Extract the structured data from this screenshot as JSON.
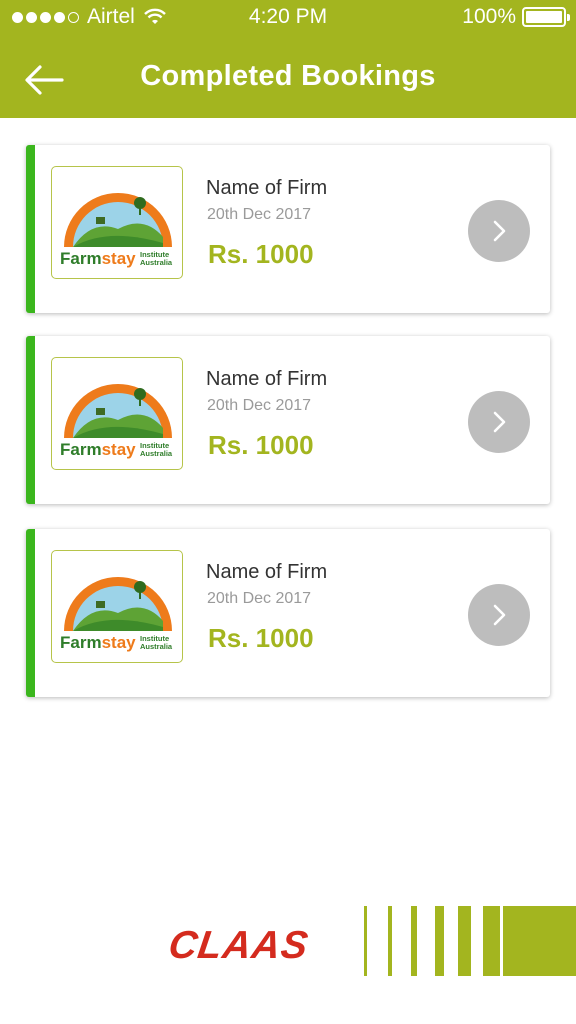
{
  "status_bar": {
    "carrier": "Airtel",
    "time": "4:20 PM",
    "battery": "100%"
  },
  "header": {
    "title": "Completed Bookings"
  },
  "bookings": [
    {
      "name": "Name of Firm",
      "date": "20th Dec 2017",
      "price": "Rs. 1000"
    },
    {
      "name": "Name of Firm",
      "date": "20th Dec 2017",
      "price": "Rs. 1000"
    },
    {
      "name": "Name of Firm",
      "date": "20th Dec 2017",
      "price": "Rs. 1000"
    }
  ],
  "logo_text": {
    "brand": "Farmstay",
    "sub1": "Institute",
    "sub2": "Australia"
  },
  "footer": {
    "brand": "CLAAS"
  },
  "colors": {
    "header": "#a3b51f",
    "accent_bar": "#3bb61d",
    "price": "#a3b51f",
    "claas_red": "#d42b1e"
  }
}
